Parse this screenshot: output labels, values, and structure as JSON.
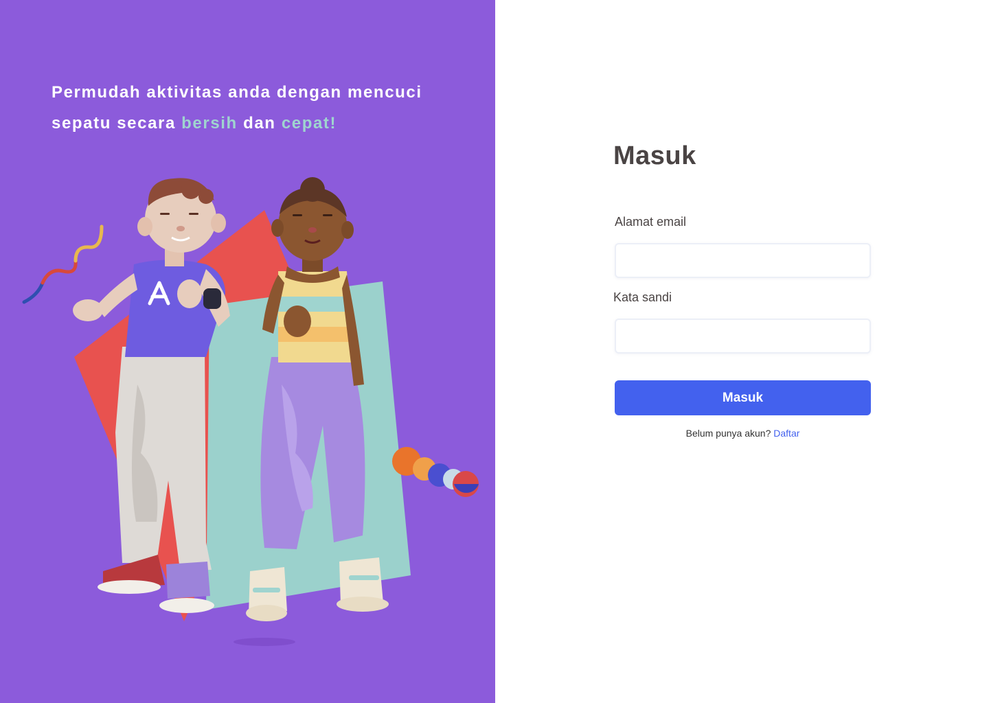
{
  "hero": {
    "tagline_part1": "Permudah aktivitas anda dengan mencuci sepatu secara ",
    "tagline_highlight1": "bersih",
    "tagline_part2": " dan ",
    "tagline_highlight2": "cepat!",
    "background_color": "#8c5bdb",
    "accent_color": "#9fd4cf",
    "illustration": "two-3d-characters-thumbs-up"
  },
  "login": {
    "title": "Masuk",
    "email_label": "Alamat email",
    "email_value": "",
    "password_label": "Kata sandi",
    "password_value": "",
    "submit_label": "Masuk",
    "register_prompt": "Belum punya akun?",
    "register_link": "Daftar",
    "button_color": "#4361ee"
  }
}
